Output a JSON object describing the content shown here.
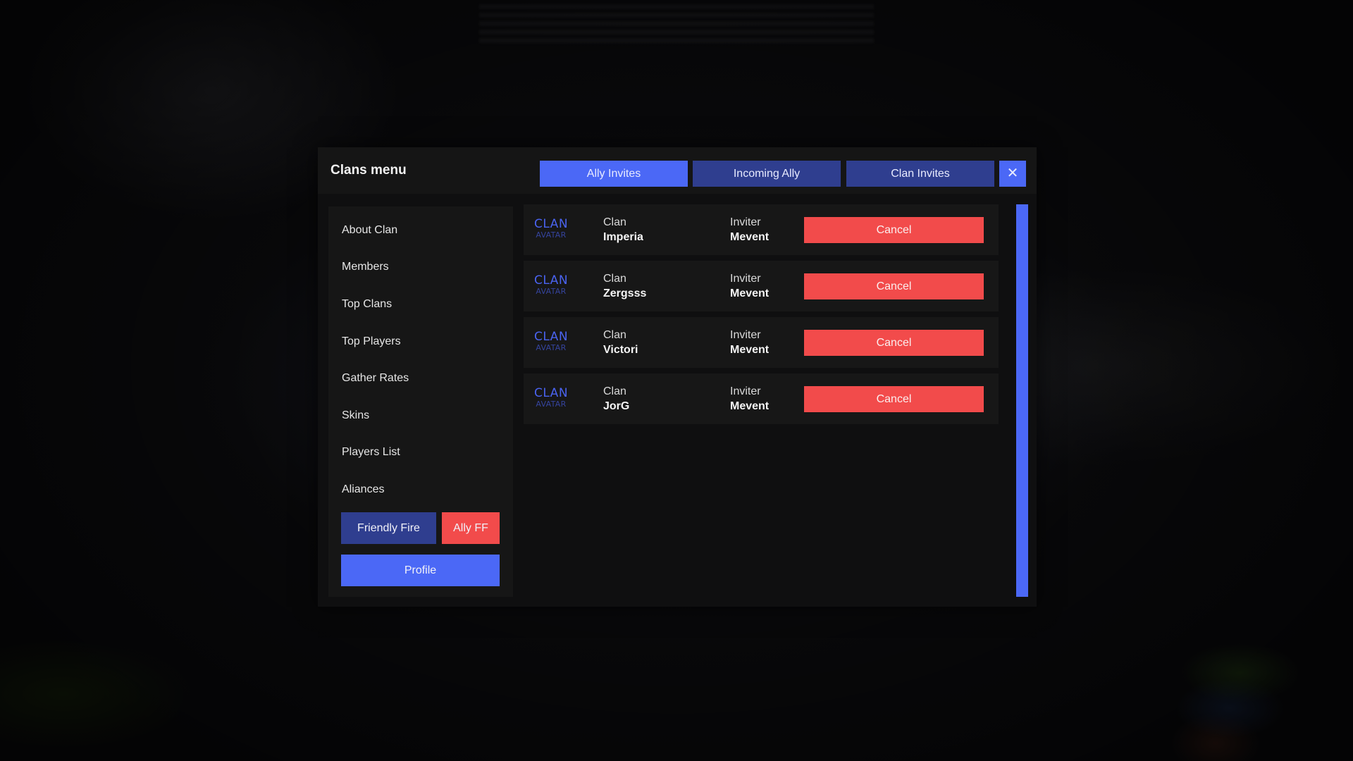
{
  "window": {
    "title": "Clans menu",
    "close_icon": "close-icon (×)",
    "close_glyph": "✕"
  },
  "tabs": [
    {
      "label": "Ally Invites",
      "active": true
    },
    {
      "label": "Incoming Ally",
      "active": false
    },
    {
      "label": "Clan Invites",
      "active": false
    }
  ],
  "sidebar": {
    "items": [
      {
        "label": "About Clan"
      },
      {
        "label": "Members"
      },
      {
        "label": "Top Clans"
      },
      {
        "label": "Top Players"
      },
      {
        "label": "Gather Rates"
      },
      {
        "label": "Skins"
      },
      {
        "label": "Players List"
      },
      {
        "label": "Aliances"
      }
    ],
    "friendly_fire_label": "Friendly Fire",
    "ally_ff_label": "Ally FF",
    "profile_label": "Profile"
  },
  "invites": {
    "avatar_line1": "CLAN",
    "avatar_line2": "AVATAR",
    "clan_label": "Clan",
    "inviter_label": "Inviter",
    "cancel_label": "Cancel",
    "rows": [
      {
        "clan": "Imperia",
        "inviter": "Mevent"
      },
      {
        "clan": "Zergsss",
        "inviter": "Mevent"
      },
      {
        "clan": "Victori",
        "inviter": "Mevent"
      },
      {
        "clan": "JorG",
        "inviter": "Mevent"
      }
    ]
  },
  "colors": {
    "accent": "#4b68f6",
    "accent_dark": "#2f3e8f",
    "danger": "#f24b4b",
    "panel_bg": "#0f0f10",
    "surface": "#161616"
  }
}
